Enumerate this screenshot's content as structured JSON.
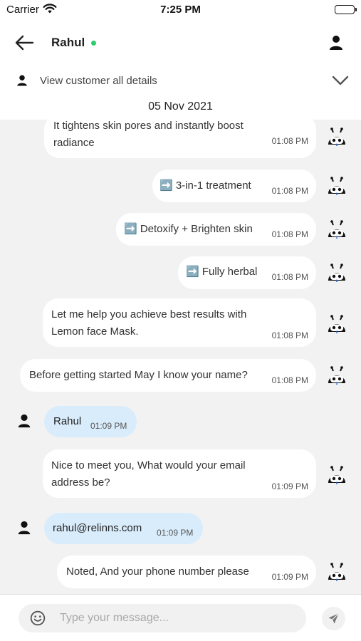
{
  "status_bar": {
    "carrier": "Carrier",
    "time": "7:25 PM"
  },
  "header": {
    "contact_name": "Rahul",
    "online_color": "#2ecc71"
  },
  "details": {
    "label": "View customer all details"
  },
  "date_label": "05 Nov 2021",
  "messages": [
    {
      "sender": "bot",
      "text": "It tightens skin pores and instantly boost\nradiance",
      "time": "01:08 PM"
    },
    {
      "sender": "bot",
      "text": "➡️ 3-in-1 treatment",
      "time": "01:08 PM"
    },
    {
      "sender": "bot",
      "text": "➡️ Detoxify + Brighten skin",
      "time": "01:08 PM"
    },
    {
      "sender": "bot",
      "text": "➡️ Fully herbal",
      "time": "01:08 PM"
    },
    {
      "sender": "bot",
      "text": "Let me help you achieve best results with\nLemon face Mask.",
      "time": "01:08 PM"
    },
    {
      "sender": "bot",
      "text": "Before getting started May I know your name?",
      "time": "01:08 PM"
    },
    {
      "sender": "user",
      "text": "Rahul",
      "time": "01:09 PM"
    },
    {
      "sender": "bot",
      "text": "Nice to meet you, What would your email\naddress be?",
      "time": "01:09 PM"
    },
    {
      "sender": "user",
      "text": "rahul@relinns.com",
      "time": "01:09 PM"
    },
    {
      "sender": "bot",
      "text": "Noted, And your phone number please",
      "time": "01:09 PM"
    }
  ],
  "input": {
    "placeholder": "Type your message..."
  },
  "colors": {
    "user_bubble": "#d9ecfb",
    "bot_bubble": "#ffffff",
    "background": "#f2f2f2"
  }
}
